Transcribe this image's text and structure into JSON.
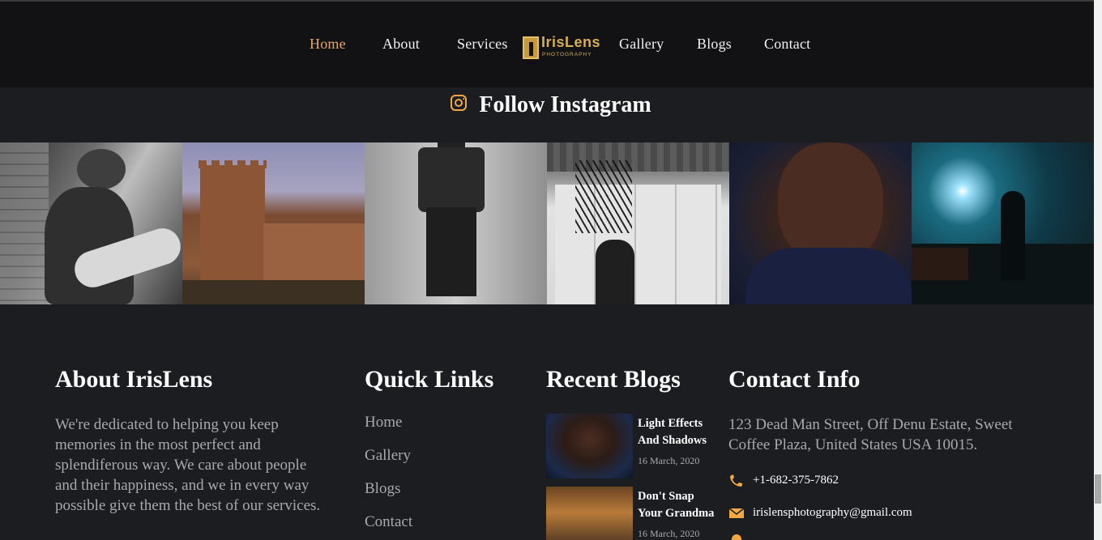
{
  "nav": {
    "items": [
      "Home",
      "About",
      "Services",
      "Gallery",
      "Blogs",
      "Contact"
    ],
    "active": "Home",
    "logo_text": "IrisLens",
    "logo_sub": "PHOTOGRAPHY"
  },
  "instagram": {
    "title": "Follow Instagram",
    "icon": "instagram-icon"
  },
  "about": {
    "title": "About IrisLens",
    "text": "We're dedicated to helping you keep memories in the most perfect and splendiferous way. We care about people and their happiness, and we in every way possible give them the best of our services."
  },
  "quick_links": {
    "title": "Quick Links",
    "items": [
      "Home",
      "Gallery",
      "Blogs",
      "Contact"
    ]
  },
  "recent_blogs": {
    "title": "Recent Blogs",
    "items": [
      {
        "title": "Light Effects And Shadows",
        "date": "16 March, 2020"
      },
      {
        "title": "Don't Snap Your Grandma",
        "date": "16 March, 2020"
      }
    ]
  },
  "contact": {
    "title": "Contact Info",
    "address": "123 Dead Man Street, Off Denu Estate, Sweet Coffee Plaza, United States USA 10015.",
    "phone": "+1-682-375-7862",
    "email": "irislensphotography@gmail.com",
    "accent": "#f0a845"
  },
  "colors": {
    "nav_active": "#e0a865",
    "background": "#1c1d20",
    "topbar": "#121214"
  }
}
